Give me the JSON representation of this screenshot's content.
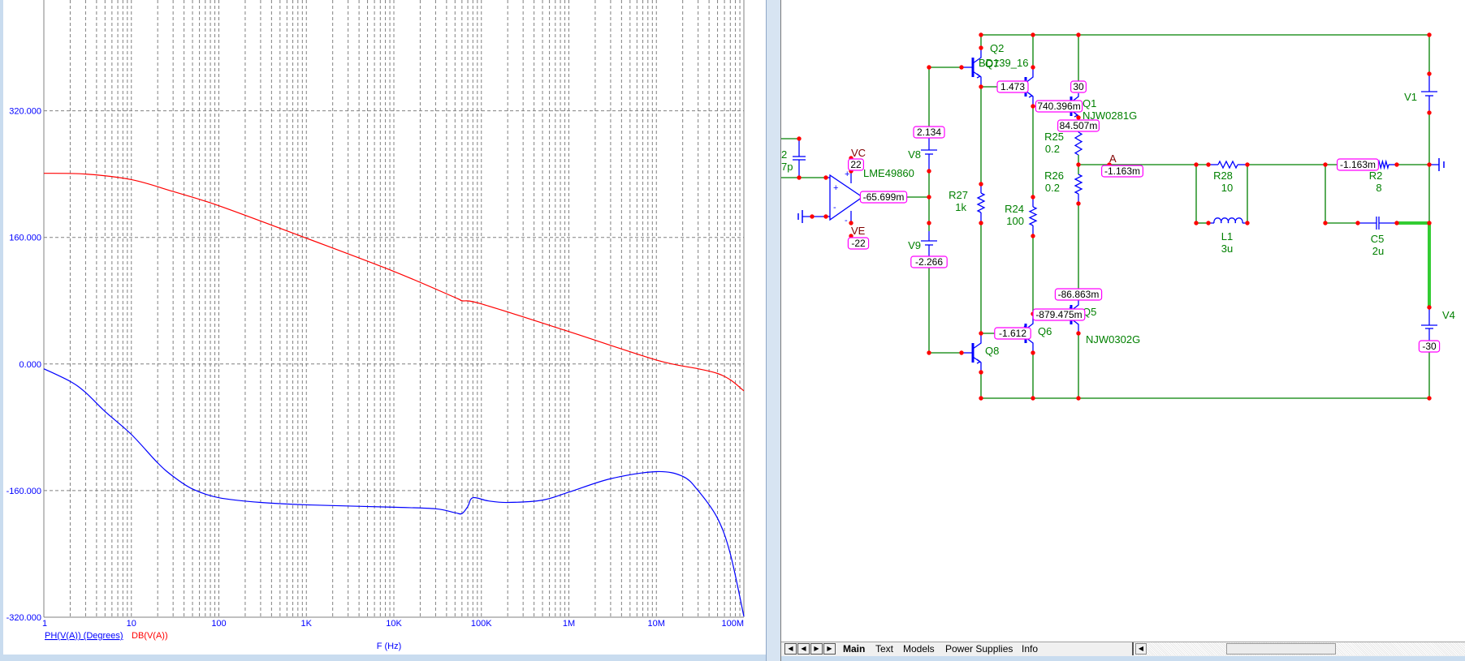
{
  "chart_data": {
    "type": "line",
    "xscale": "log",
    "xlabel": "F (Hz)",
    "xlim": [
      1,
      100000000
    ],
    "x_tick_labels": [
      "1",
      "10",
      "100",
      "1K",
      "10K",
      "100K",
      "1M",
      "10M",
      "100M"
    ],
    "ylim": [
      -320,
      460
    ],
    "y_ticks": [
      320,
      160,
      0,
      -160,
      -320
    ],
    "y_tick_labels": [
      "320.000",
      "160.000",
      "0.000",
      "-160.000",
      "-320.000"
    ],
    "grid": true,
    "legend_placement": "bottom-left",
    "series": [
      {
        "name": "PH(V(A)) (Degrees)",
        "color": "#0000ff",
        "x": [
          1,
          2,
          3,
          5,
          10,
          20,
          30,
          50,
          100,
          300,
          1000,
          10000,
          30000,
          50000,
          60000,
          70000,
          80000,
          120000,
          200000,
          500000,
          1000000,
          3000000,
          10000000,
          20000000,
          30000000,
          50000000,
          70000000,
          100000000
        ],
        "y": [
          -6,
          -22,
          -36,
          -60,
          -89,
          -125,
          -142,
          -158,
          -169,
          -175,
          -178,
          -181,
          -183,
          -188,
          -189,
          -180,
          -169,
          -173,
          -175,
          -172,
          -162,
          -145,
          -136,
          -142,
          -160,
          -195,
          -240,
          -319
        ]
      },
      {
        "name": "DB(V(A))",
        "color": "#ff0000",
        "x": [
          1,
          3,
          10,
          30,
          100,
          1000,
          10000,
          50000,
          60000,
          100000,
          1000000,
          10000000,
          30000000,
          50000000,
          70000000,
          100000000
        ],
        "y": [
          241,
          240,
          233,
          218,
          200,
          159,
          117,
          84,
          80,
          76,
          41,
          5,
          -6,
          -12,
          -20,
          -34
        ]
      }
    ]
  },
  "schematic": {
    "labels": {
      "q2": "Q2",
      "q2_model": "BD139_16",
      "q7": "Q7",
      "q1": "Q1",
      "q1_model": "NJW0281G",
      "q5": "Q5",
      "q5_model": "NJW0302G",
      "q6": "Q6",
      "q8": "Q8",
      "r25": "R25",
      "r25_val": "0.2",
      "r26": "R26",
      "r26_val": "0.2",
      "r27": "R27",
      "r27_val": "1k",
      "r24": "R24",
      "r24_val": "100",
      "r28": "R28",
      "r28_val": "10",
      "l1": "L1",
      "l1_val": "3u",
      "r2": "R2",
      "r2_val": "8",
      "c5": "C5",
      "c5_val": "2u",
      "v1": "V1",
      "v4": "V4",
      "v8": "V8",
      "v9": "V9",
      "opamp": "LME49860",
      "vc": "VC",
      "ve": "VE",
      "node_a": "A",
      "cap_name_partial": "2",
      "cap_val_partial": "7p"
    },
    "node_values": {
      "v1473": "1.473",
      "v30": "30",
      "v740": "740.396m",
      "v84": "84.507m",
      "v2134": "2.134",
      "v22": "22",
      "vout": "-65.699m",
      "vm22": "-22",
      "va": "-1.163m",
      "vr2": "-1.163m",
      "vm2266": "-2.266",
      "vm86": "-86.863m",
      "vm879": "-879.475m",
      "vm1612": "-1.612",
      "vm30": "-30"
    },
    "colors": {
      "wire": "#008000",
      "component": "#0000ff",
      "node": "#ff0000",
      "value_box": "#ff00ff",
      "selected_wire": "#33cc33"
    }
  },
  "tabs": {
    "items": [
      "Main",
      "Text",
      "Models",
      "Power Supplies",
      "Info"
    ],
    "active": "Main",
    "nav_icons": [
      "first-icon",
      "prev-icon",
      "next-icon",
      "last-icon"
    ]
  }
}
